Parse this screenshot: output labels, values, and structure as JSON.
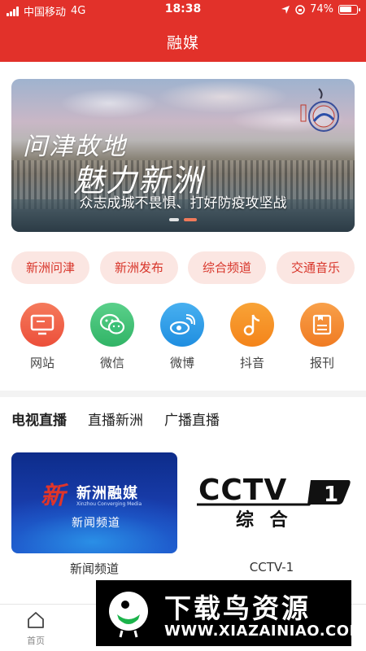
{
  "status_bar": {
    "carrier": "中国移动",
    "network": "4G",
    "time": "18:38",
    "battery": "74%",
    "battery_level": 0.74
  },
  "header": {
    "title": "融媒"
  },
  "banner": {
    "calligraphy_line1": "问津故地",
    "calligraphy_line2": "魅力新洲",
    "seal_text": "魅力新洲",
    "caption": "众志成城不畏惧、打好防疫攻坚战",
    "active_slide": 1,
    "slide_count": 2
  },
  "channel_pills": [
    {
      "label": "新洲问津"
    },
    {
      "label": "新洲发布"
    },
    {
      "label": "综合频道"
    },
    {
      "label": "交通音乐"
    }
  ],
  "quick_links": [
    {
      "label": "网站",
      "icon": "monitor-icon",
      "color": "#f0624a"
    },
    {
      "label": "微信",
      "icon": "wechat-icon",
      "color": "#3fbf74"
    },
    {
      "label": "微博",
      "icon": "weibo-icon",
      "color": "#2b9be8"
    },
    {
      "label": "抖音",
      "icon": "music-note-icon",
      "color": "#f7901e"
    },
    {
      "label": "报刊",
      "icon": "newspaper-icon",
      "color": "#f5882a"
    }
  ],
  "live_tabs": [
    {
      "label": "电视直播",
      "active": true
    },
    {
      "label": "直播新洲",
      "active": false
    },
    {
      "label": "广播直播",
      "active": false
    }
  ],
  "live_cards": [
    {
      "label": "新闻频道",
      "logo_text": "新洲融媒",
      "logo_sub": "Xinzhou Converging Media",
      "channel_text": "新闻频道"
    },
    {
      "label": "CCTV-1",
      "logo_text": "CCTV",
      "logo_number": "1",
      "logo_sub": "综 合"
    }
  ],
  "bottom_nav": {
    "home_label": "首页"
  },
  "watermark": {
    "title": "下载鸟资源",
    "url": "WWW.XIAZAINIAO.COM"
  },
  "colors": {
    "brand_red": "#e2312a",
    "pill_bg": "#fbe6e2",
    "pill_text": "#d8352a"
  }
}
